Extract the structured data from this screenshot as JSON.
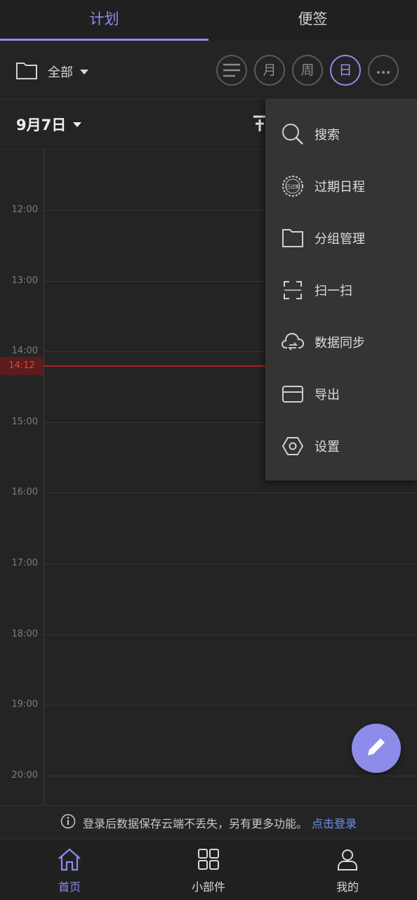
{
  "tabs": {
    "plan": "计划",
    "notes": "便签"
  },
  "toolbar": {
    "group": "全部",
    "views": {
      "list_icon": "list-icon",
      "month": "月",
      "week": "周",
      "day": "日",
      "more_icon": "more-icon"
    }
  },
  "date_row": {
    "date": "9月7日"
  },
  "timeline": {
    "hours": [
      "12:00",
      "13:00",
      "14:00",
      "15:00",
      "16:00",
      "17:00",
      "18:00",
      "19:00",
      "20:00"
    ],
    "current_time": "14:12"
  },
  "menu": {
    "items": [
      {
        "label": "搜索",
        "icon": "search-icon"
      },
      {
        "label": "过期日程",
        "icon": "expired-stamp-icon"
      },
      {
        "label": "分组管理",
        "icon": "folder-icon"
      },
      {
        "label": "扫一扫",
        "icon": "scan-icon"
      },
      {
        "label": "数据同步",
        "icon": "cloud-sync-icon"
      },
      {
        "label": "导出",
        "icon": "export-icon"
      },
      {
        "label": "设置",
        "icon": "settings-icon"
      }
    ],
    "stamp_text": "已过期"
  },
  "banner": {
    "text": "登录后数据保存云端不丢失，另有更多功能。",
    "link": "点击登录"
  },
  "bottom_nav": {
    "home": "首页",
    "widgets": "小部件",
    "mine": "我的"
  },
  "colors": {
    "accent": "#8e8cea",
    "now_line": "#b32020",
    "link": "#6f8ff0",
    "background": "#242424"
  }
}
